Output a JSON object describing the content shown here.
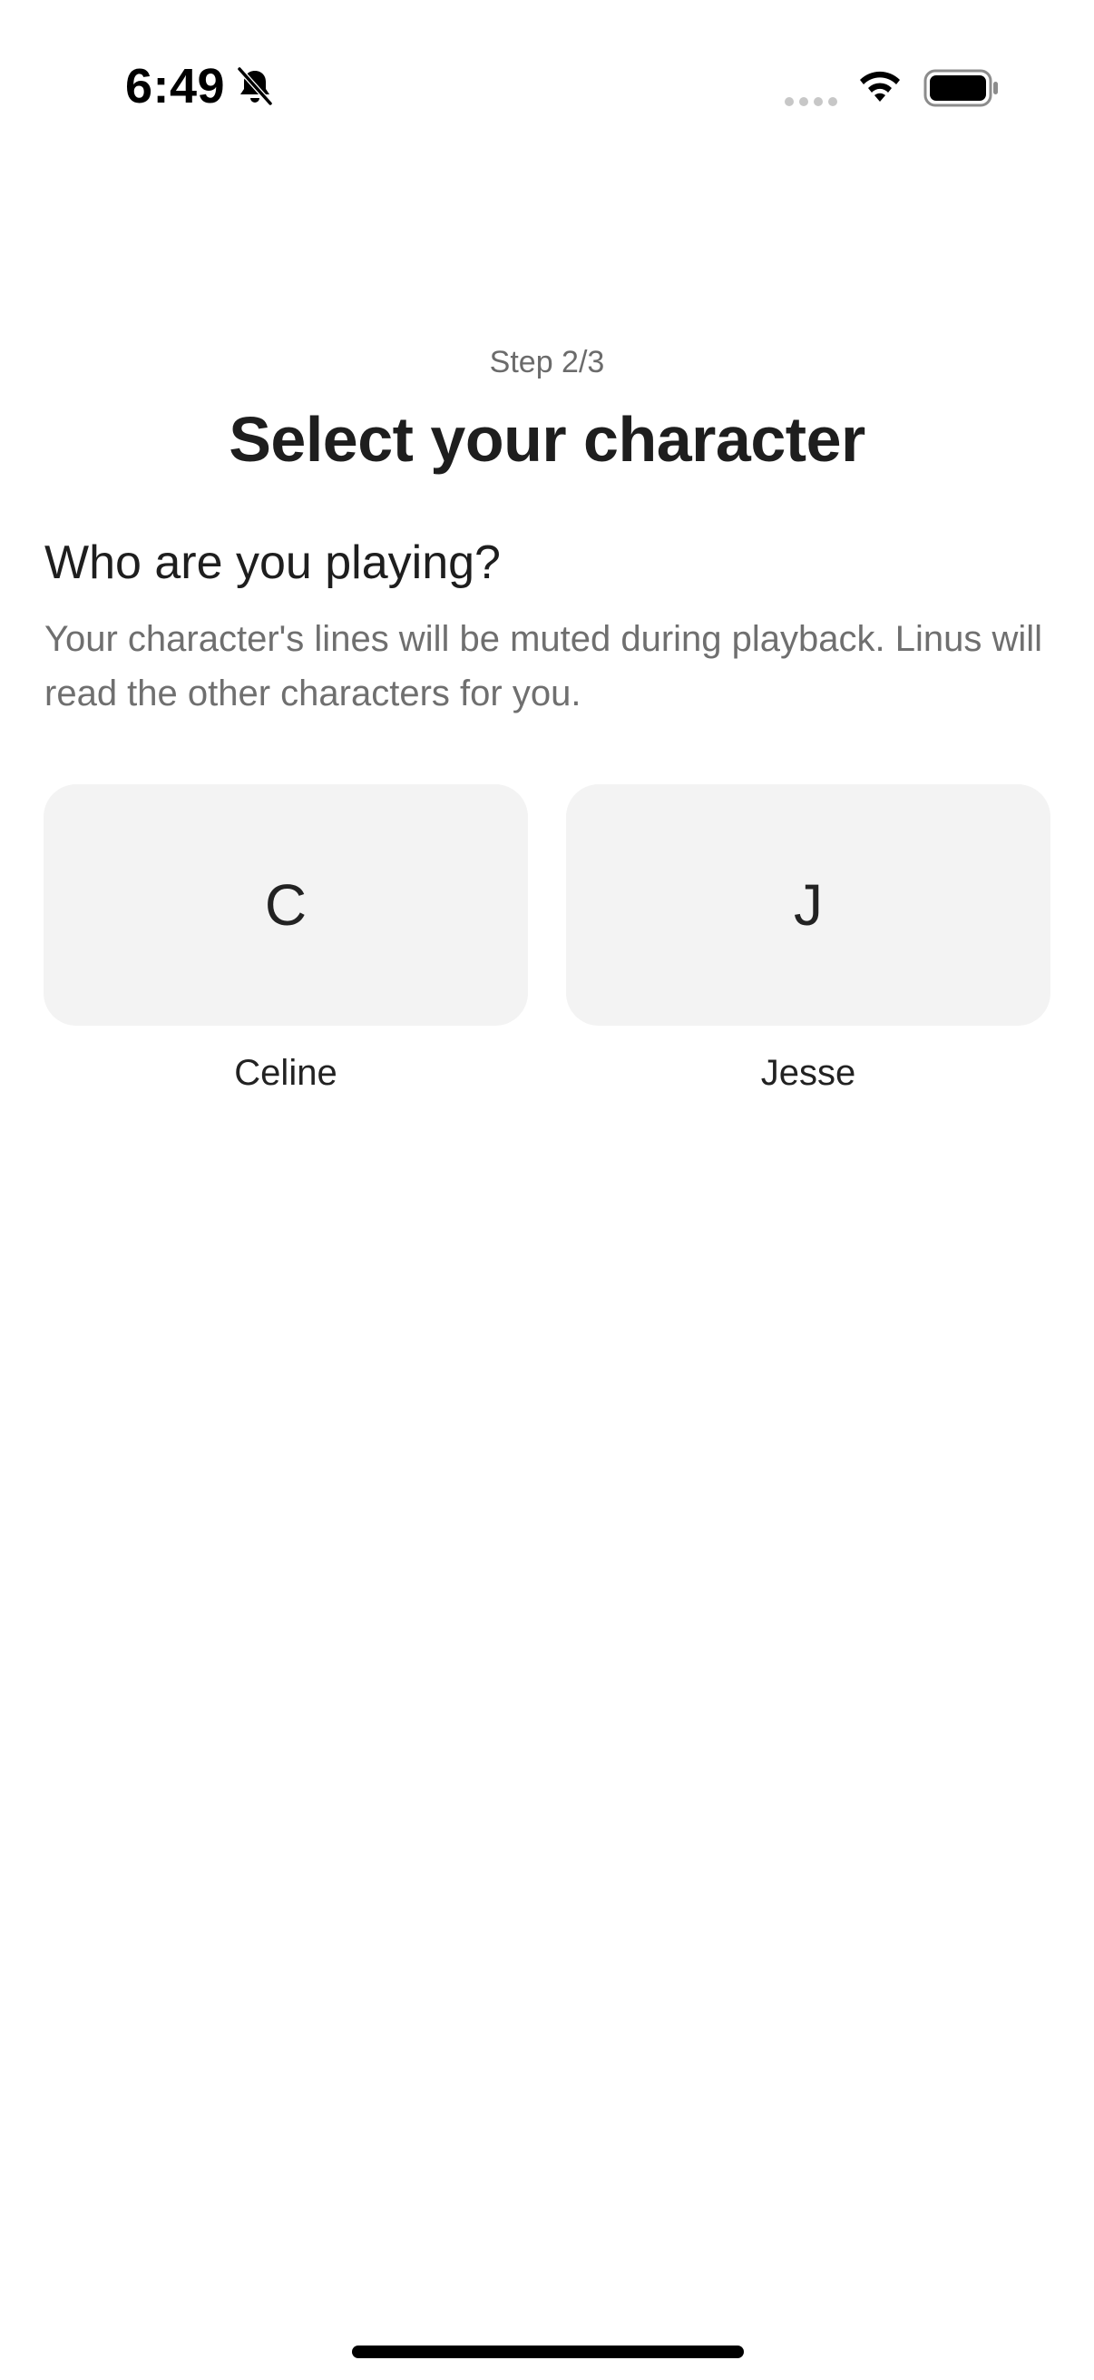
{
  "status_bar": {
    "time": "6:49",
    "icons": [
      "bell-slash-icon",
      "signal-icon",
      "wifi-icon",
      "battery-icon"
    ]
  },
  "onboarding": {
    "step_label": "Step 2/3",
    "title": "Select your character",
    "question": "Who are you playing?",
    "description": "Your character's lines will be muted during playback. Linus will read the other characters for you."
  },
  "characters": [
    {
      "initial": "C",
      "name": "Celine"
    },
    {
      "initial": "J",
      "name": "Jesse"
    }
  ],
  "colors": {
    "card_background": "#f3f3f3",
    "secondary_text": "#6f6f6f",
    "primary_text": "#1e1e1e"
  }
}
